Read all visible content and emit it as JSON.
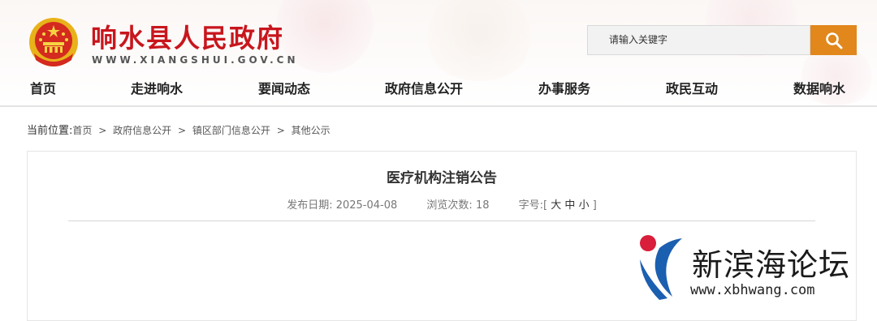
{
  "header": {
    "site_title": "响水县人民政府",
    "site_url": "WWW.XIANGSHUI.GOV.CN",
    "search": {
      "placeholder": "请输入关键字",
      "icon": "search-icon"
    }
  },
  "nav": {
    "items": [
      "首页",
      "走进响水",
      "要闻动态",
      "政府信息公开",
      "办事服务",
      "政民互动",
      "数据响水"
    ]
  },
  "breadcrumb": {
    "lead": "当前位置:",
    "items": [
      "首页",
      "政府信息公开",
      "镇区部门信息公开",
      "其他公示"
    ],
    "separator": ">"
  },
  "article": {
    "title": "医疗机构注销公告",
    "date_label": "发布日期:",
    "date": "2025-04-08",
    "views_label": "浏览次数:",
    "views": "18",
    "font_label": "字号:",
    "font_open": "[",
    "font_large": "大",
    "font_medium": "中",
    "font_small": "小",
    "font_close": "]"
  },
  "watermark": {
    "text": "新滨海论坛",
    "url": "www.xbhwang.com"
  },
  "colors": {
    "brand_red": "#c8161d",
    "search_orange": "#e1871b",
    "watermark_red": "#d81e3a",
    "watermark_blue": "#1b5fb0"
  }
}
